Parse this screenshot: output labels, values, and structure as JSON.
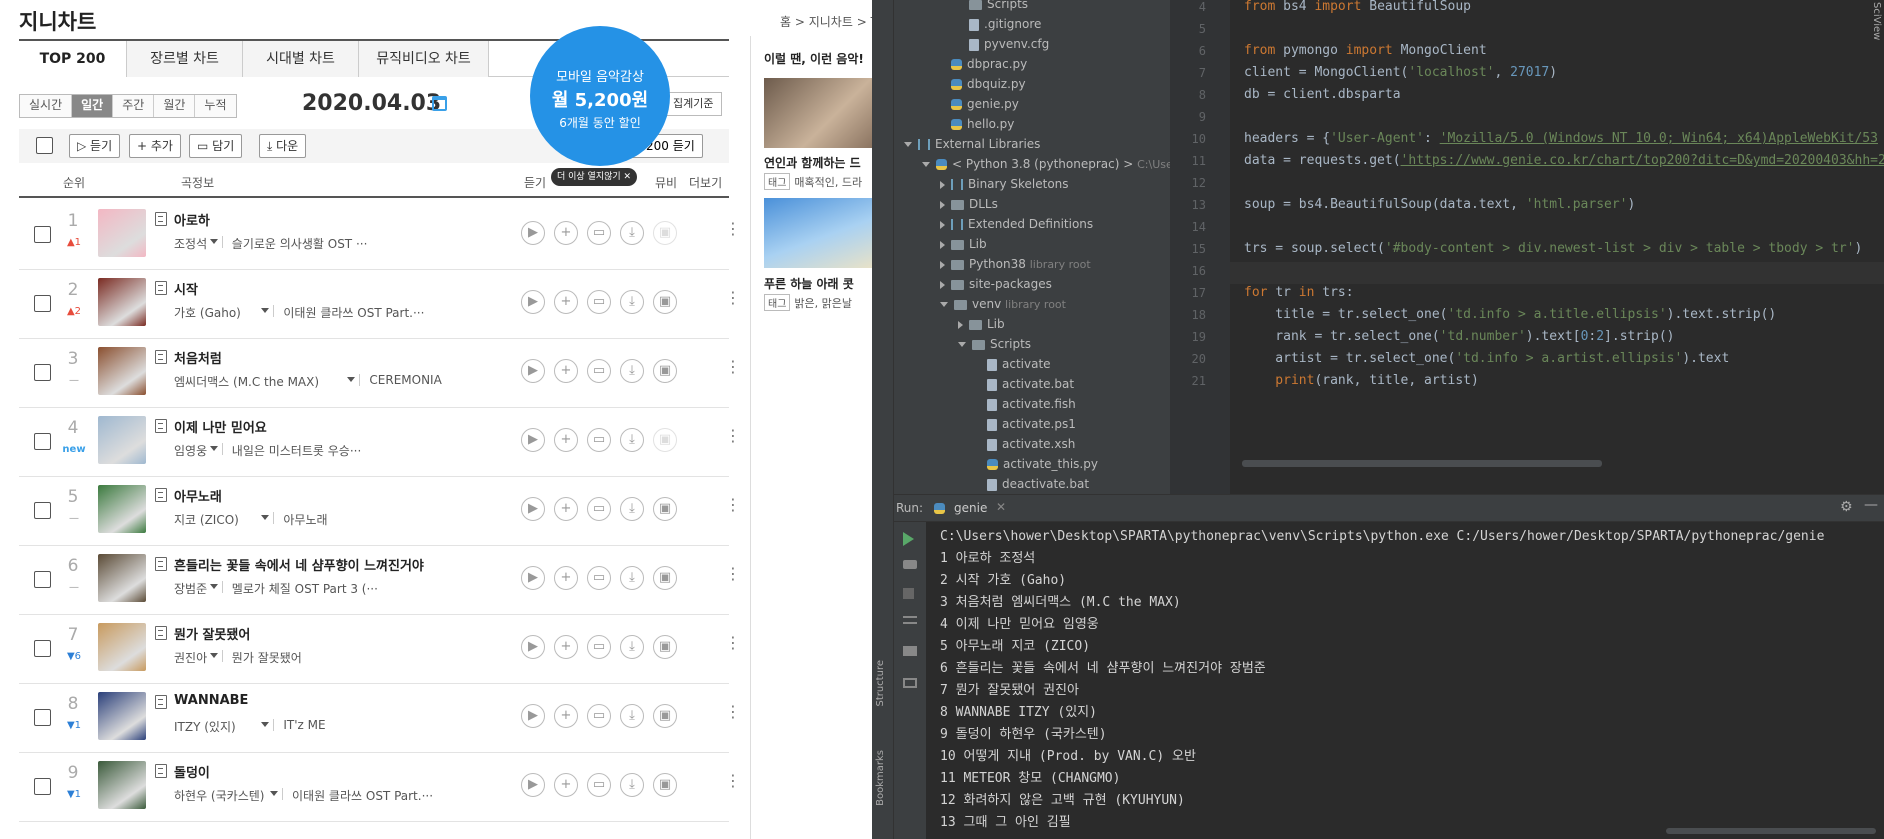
{
  "browser": {
    "site_title": "지니차트",
    "breadcrumb": "홈 > 지니차트 > TO",
    "tabs": [
      "TOP 200",
      "장르별 차트",
      "시대별 차트",
      "뮤직비디오 차트"
    ],
    "periods": [
      "실시간",
      "일간",
      "주간",
      "월간",
      "누적"
    ],
    "active_period": "일간",
    "date": "2020.04.03",
    "agg_label": "집계기준",
    "toolbar": {
      "play": "듣기",
      "add": "추가",
      "save": "담기",
      "download": "다운",
      "top200_play": "TOP200 듣기"
    },
    "columns": {
      "rank": "순위",
      "info": "곡정보",
      "listen": "듣기",
      "mv": "뮤비",
      "more": "더보기"
    },
    "promo": {
      "line1": "모바일 음악감상",
      "line2": "월 5,200원",
      "line3": "6개월 동안 할인",
      "close": "더 이상 열지않기 ✕"
    },
    "side": {
      "heading": "이럴 땐, 이런 음악!",
      "cap1": "연인과 함께하는 드",
      "tag1_label": "태그",
      "tag1": "매혹적인, 드라",
      "cap2": "푸른 하늘 아래 콧",
      "tag2_label": "태그",
      "tag2": "밝은, 맑은날"
    },
    "songs": [
      {
        "rank": "1",
        "change": "▲1",
        "change_type": "up",
        "title": "아로하",
        "artist": "조정석",
        "album": "슬기로운 의사생활 OST ···",
        "thumb": "#f3b7c3"
      },
      {
        "rank": "2",
        "change": "▲2",
        "change_type": "up",
        "title": "시작",
        "artist": "가호 (Gaho)",
        "album": "이태원 클라쓰 OST Part.···",
        "thumb": "#7a2b22"
      },
      {
        "rank": "3",
        "change": "—",
        "change_type": "same",
        "title": "처음처럼",
        "artist": "엠씨더맥스 (M.C the MAX)",
        "album": "CEREMONIA",
        "thumb": "#8a4f2f"
      },
      {
        "rank": "4",
        "change": "new",
        "change_type": "new",
        "title": "이제 나만 믿어요",
        "artist": "임영웅",
        "album": "내일은 미스터트롯 우승···",
        "thumb": "#9fb8d0"
      },
      {
        "rank": "5",
        "change": "—",
        "change_type": "same",
        "title": "아무노래",
        "artist": "지코 (ZICO)",
        "album": "아무노래",
        "thumb": "#3b7a3e"
      },
      {
        "rank": "6",
        "change": "—",
        "change_type": "same",
        "title": "흔들리는 꽃들 속에서 네 샴푸향이 느껴진거야",
        "artist": "장범준",
        "album": "멜로가 체질 OST Part 3 (···",
        "thumb": "#5a4a35"
      },
      {
        "rank": "7",
        "change": "▼6",
        "change_type": "down",
        "title": "뭔가 잘못됐어",
        "artist": "권진아",
        "album": "뭔가 잘못됐어",
        "thumb": "#c89a5e"
      },
      {
        "rank": "8",
        "change": "▼1",
        "change_type": "down",
        "title": "WANNABE",
        "artist": "ITZY (있지)",
        "album": "IT'z ME",
        "thumb": "#2a3f7a"
      },
      {
        "rank": "9",
        "change": "▼1",
        "change_type": "down",
        "title": "돌덩이",
        "artist": "하현우 (국카스텐)",
        "album": "이태원 클라쓰 OST Part.···",
        "thumb": "#3a5a3a"
      }
    ]
  },
  "ide": {
    "tree": [
      {
        "label": "Scripts",
        "kind": "folder",
        "indent": 3,
        "arrow": "none"
      },
      {
        "label": ".gitignore",
        "kind": "file",
        "indent": 3,
        "arrow": "none"
      },
      {
        "label": "pyvenv.cfg",
        "kind": "file",
        "indent": 3,
        "arrow": "none"
      },
      {
        "label": "dbprac.py",
        "kind": "py",
        "indent": 2,
        "arrow": "none"
      },
      {
        "label": "dbquiz.py",
        "kind": "py",
        "indent": 2,
        "arrow": "none"
      },
      {
        "label": "genie.py",
        "kind": "py",
        "indent": 2,
        "arrow": "none"
      },
      {
        "label": "hello.py",
        "kind": "py",
        "indent": 2,
        "arrow": "none"
      },
      {
        "label": "External Libraries",
        "kind": "libs",
        "indent": 0,
        "arrow": "down"
      },
      {
        "label": "< Python 3.8 (pythoneprac) >",
        "hint": "C:\\Users",
        "kind": "py",
        "indent": 1,
        "arrow": "down"
      },
      {
        "label": "Binary Skeletons",
        "kind": "libs",
        "indent": 2,
        "arrow": "right"
      },
      {
        "label": "DLLs",
        "kind": "folder",
        "indent": 2,
        "arrow": "right"
      },
      {
        "label": "Extended Definitions",
        "kind": "libs",
        "indent": 2,
        "arrow": "right"
      },
      {
        "label": "Lib",
        "kind": "folder",
        "indent": 2,
        "arrow": "right"
      },
      {
        "label": "Python38",
        "hint": "library root",
        "kind": "folder",
        "indent": 2,
        "arrow": "right"
      },
      {
        "label": "site-packages",
        "kind": "folder",
        "indent": 2,
        "arrow": "right"
      },
      {
        "label": "venv",
        "hint": "library root",
        "kind": "folder",
        "indent": 2,
        "arrow": "down"
      },
      {
        "label": "Lib",
        "kind": "folder",
        "indent": 3,
        "arrow": "right"
      },
      {
        "label": "Scripts",
        "kind": "folder",
        "indent": 3,
        "arrow": "down"
      },
      {
        "label": "activate",
        "kind": "file",
        "indent": 4,
        "arrow": "none"
      },
      {
        "label": "activate.bat",
        "kind": "file",
        "indent": 4,
        "arrow": "none"
      },
      {
        "label": "activate.fish",
        "kind": "file",
        "indent": 4,
        "arrow": "none"
      },
      {
        "label": "activate.ps1",
        "kind": "file",
        "indent": 4,
        "arrow": "none"
      },
      {
        "label": "activate.xsh",
        "kind": "file",
        "indent": 4,
        "arrow": "none"
      },
      {
        "label": "activate_this.py",
        "kind": "py",
        "indent": 4,
        "arrow": "none"
      },
      {
        "label": "deactivate.bat",
        "kind": "file",
        "indent": 4,
        "arrow": "none"
      }
    ],
    "line_numbers": [
      "4",
      "5",
      "6",
      "7",
      "8",
      "9",
      "10",
      "11",
      "12",
      "13",
      "14",
      "15",
      "16",
      "17",
      "18",
      "19",
      "20",
      "21"
    ],
    "code": [
      [
        [
          "kw",
          "from "
        ],
        [
          "",
          "bs4 "
        ],
        [
          "kw",
          "import "
        ],
        [
          "",
          "BeautifulSoup"
        ]
      ],
      [],
      [
        [
          "kw",
          "from "
        ],
        [
          "",
          "pymongo "
        ],
        [
          "kw",
          "import "
        ],
        [
          "",
          "MongoClient"
        ]
      ],
      [
        [
          "",
          "client = MongoClient("
        ],
        [
          "st",
          "'localhost'"
        ],
        [
          "",
          ", "
        ],
        [
          "nm",
          "27017"
        ],
        [
          "",
          ")"
        ]
      ],
      [
        [
          "",
          "db = client.dbsparta"
        ]
      ],
      [],
      [
        [
          "",
          "headers = {"
        ],
        [
          "st",
          "'User-Agent'"
        ],
        [
          "",
          ": "
        ],
        [
          "ul",
          "'Mozilla/5.0 (Windows NT 10.0; Win64; x64)AppleWebKit/53"
        ]
      ],
      [
        [
          "",
          "data = requests.get("
        ],
        [
          "ul",
          "'https://www.genie.co.kr/chart/top200?ditc=D&ymd=20200403&hh=2"
        ]
      ],
      [],
      [
        [
          "",
          "soup = bs4.BeautifulSoup(data.text, "
        ],
        [
          "st",
          "'html.parser'"
        ],
        [
          "",
          ")"
        ]
      ],
      [],
      [
        [
          "",
          "trs = soup.select("
        ],
        [
          "st",
          "'#body-content > div.newest-list > div > table > tbody > tr'"
        ],
        [
          "",
          ")"
        ]
      ],
      [],
      [
        [
          "kw",
          "for "
        ],
        [
          "",
          "tr "
        ],
        [
          "kw",
          "in "
        ],
        [
          "",
          "trs:"
        ]
      ],
      [
        [
          "",
          "    title = tr.select_one("
        ],
        [
          "st",
          "'td.info > a.title.ellipsis'"
        ],
        [
          "",
          ").text.strip()"
        ]
      ],
      [
        [
          "",
          "    rank = tr.select_one("
        ],
        [
          "st",
          "'td.number'"
        ],
        [
          "",
          ").text["
        ],
        [
          "nm",
          "0"
        ],
        [
          "",
          ":"
        ],
        [
          "nm",
          "2"
        ],
        [
          "",
          "].strip()"
        ]
      ],
      [
        [
          "",
          "    artist = tr.select_one("
        ],
        [
          "st",
          "'td.info > a.artist.ellipsis'"
        ],
        [
          "",
          ").text"
        ]
      ],
      [
        [
          "kw",
          "    print"
        ],
        [
          "",
          "(rank, title, artist)"
        ]
      ]
    ],
    "run_label": "Run:",
    "run_tab": "genie",
    "side_labels": {
      "structure": "Structure",
      "bookmarks": "Bookmarks",
      "sciview": "SciView"
    },
    "console": [
      "C:\\Users\\hower\\Desktop\\SPARTA\\pythoneprac\\venv\\Scripts\\python.exe C:/Users/hower/Desktop/SPARTA/pythoneprac/genie",
      "1 아로하 조정석",
      "2 시작 가호 (Gaho)",
      "3 처음처럼 엠씨더맥스 (M.C the MAX)",
      "4 이제 나만 믿어요 임영웅",
      "5 아무노래 지코 (ZICO)",
      "6 흔들리는 꽃들 속에서 네 샴푸향이 느껴진거야 장범준",
      "7 뭔가 잘못됐어 권진아",
      "8 WANNABE ITZY (있지)",
      "9 돌덩이 하현우 (국카스텐)",
      "10 어떻게 지내 (Prod. by VAN.C) 오반",
      "11 METEOR 창모 (CHANGMO)",
      "12 화려하지 않은 고백 규현 (KYUHYUN)",
      "13 그때 그 아인 김필"
    ]
  }
}
